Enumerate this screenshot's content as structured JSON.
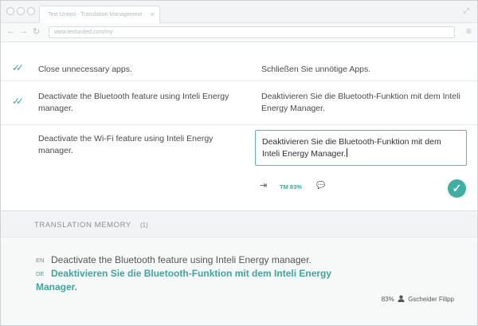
{
  "browser": {
    "tab_title": "Text United - Translation Management",
    "tab_close": "×",
    "url": "www.textunited.com/my",
    "back_icon": "←",
    "forward_icon": "→",
    "reload_icon": "↻",
    "menu_icon": "≡",
    "resize_icon": "⤢"
  },
  "segments": [
    {
      "source": "Close unnecessary apps.",
      "target": "Schließen Sie unnötige Apps.",
      "confirmed": true
    },
    {
      "source": "Deactivate the Bluetooth feature using Inteli Energy manager.",
      "target": "Deaktivieren Sie die Bluetooth-Funktion mit dem Inteli Energy Manager.",
      "confirmed": true
    },
    {
      "source": "Deactivate the Wi-Fi feature using Inteli Energy manager.",
      "target": "Deaktivieren Sie die Bluetooth-Funktion mit dem Inteli Energy Manager.",
      "confirmed": false,
      "active": true
    }
  ],
  "editor_toolbar": {
    "insert_icon": "⇥",
    "tm_match": "TM 83%",
    "comment_icon": "💬",
    "confirm_icon": "✓"
  },
  "check_icon": "✓✓",
  "translation_memory": {
    "title": "TRANSLATION MEMORY",
    "count": "(1)",
    "source_lang": "EN",
    "target_lang": "DE",
    "source_text": "Deactivate the Bluetooth feature using Inteli Energy manager.",
    "target_text": "Deaktivieren Sie die Bluetooth-Funktion mit dem Inteli Energy Manager.",
    "match": "83%",
    "author": "Gscheider Filipp"
  },
  "colors": {
    "accent": "#3aa79c",
    "confirm_button": "#3db0a3"
  }
}
